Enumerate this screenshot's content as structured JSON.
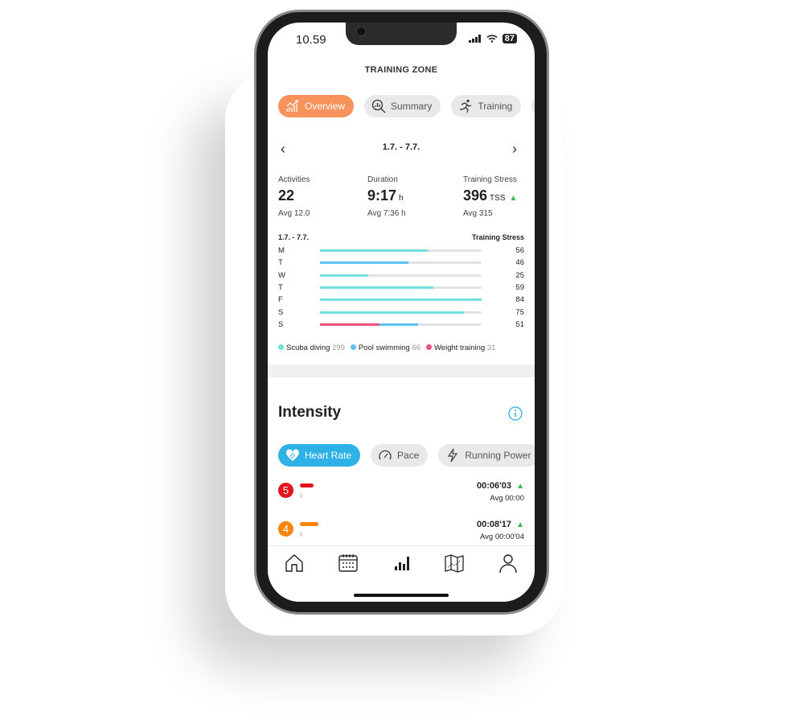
{
  "status": {
    "time": "10.59",
    "battery": "87"
  },
  "header": {
    "title": "TRAINING ZONE"
  },
  "tabs": [
    {
      "label": "Overview",
      "icon": "trend-chart-icon",
      "active": true
    },
    {
      "label": "Summary",
      "icon": "magnifier-chart-icon"
    },
    {
      "label": "Training",
      "icon": "runner-icon"
    }
  ],
  "period": {
    "range": "1.7. - 7.7."
  },
  "stats": [
    {
      "label": "Activities",
      "value": "22",
      "unit": "",
      "avg": "Avg 12.0"
    },
    {
      "label": "Duration",
      "value": "9:17",
      "unit": "h",
      "avg": "Avg 7:36 h"
    },
    {
      "label": "Training Stress",
      "value": "396",
      "unit": "TSS",
      "avg": "Avg 315",
      "trend": "up"
    }
  ],
  "chart_data": {
    "type": "bar",
    "orientation": "horizontal",
    "stacked": true,
    "title": "1.7. - 7.7.",
    "ylabel": "Training Stress",
    "categories": [
      "M",
      "T",
      "W",
      "T",
      "F",
      "S",
      "S"
    ],
    "totals": [
      56,
      46,
      25,
      59,
      84,
      75,
      51
    ],
    "xlim": [
      0,
      84
    ],
    "series": [
      {
        "name": "Scuba diving",
        "color": "#6fe0dc",
        "values": [
          56,
          0,
          25,
          59,
          84,
          75,
          0
        ]
      },
      {
        "name": "Pool swimming",
        "color": "#5ec2f5",
        "values": [
          0,
          46,
          0,
          0,
          0,
          0,
          20
        ]
      },
      {
        "name": "Weight training",
        "color": "#f2507a",
        "values": [
          0,
          0,
          0,
          0,
          0,
          0,
          31
        ]
      }
    ]
  },
  "legend": [
    {
      "name": "Scuba diving",
      "total": "299",
      "color": "#6fe0dc"
    },
    {
      "name": "Pool swimming",
      "total": "66",
      "color": "#5ec2f5"
    },
    {
      "name": "Weight training",
      "total": "31",
      "color": "#f2507a"
    }
  ],
  "intensity": {
    "title": "Intensity",
    "tabs": [
      {
        "label": "Heart Rate",
        "icon": "heart-icon",
        "active": true
      },
      {
        "label": "Pace",
        "icon": "gauge-icon"
      },
      {
        "label": "Running Power",
        "icon": "lightning-icon"
      }
    ],
    "zones": [
      {
        "zone": "5",
        "color": "#e3141c",
        "time": "00:06'03",
        "avg": "Avg 00:00"
      },
      {
        "zone": "4",
        "color": "#f7850f",
        "time": "00:08'17",
        "avg": "Avg 00:00'04"
      }
    ]
  },
  "colors": {
    "accent_orange": "#f7935b",
    "accent_blue": "#2eb1e6",
    "trend_up": "#3bb55a"
  },
  "bottom_nav": [
    "home-icon",
    "calendar-icon",
    "stats-icon",
    "map-icon",
    "profile-icon"
  ]
}
